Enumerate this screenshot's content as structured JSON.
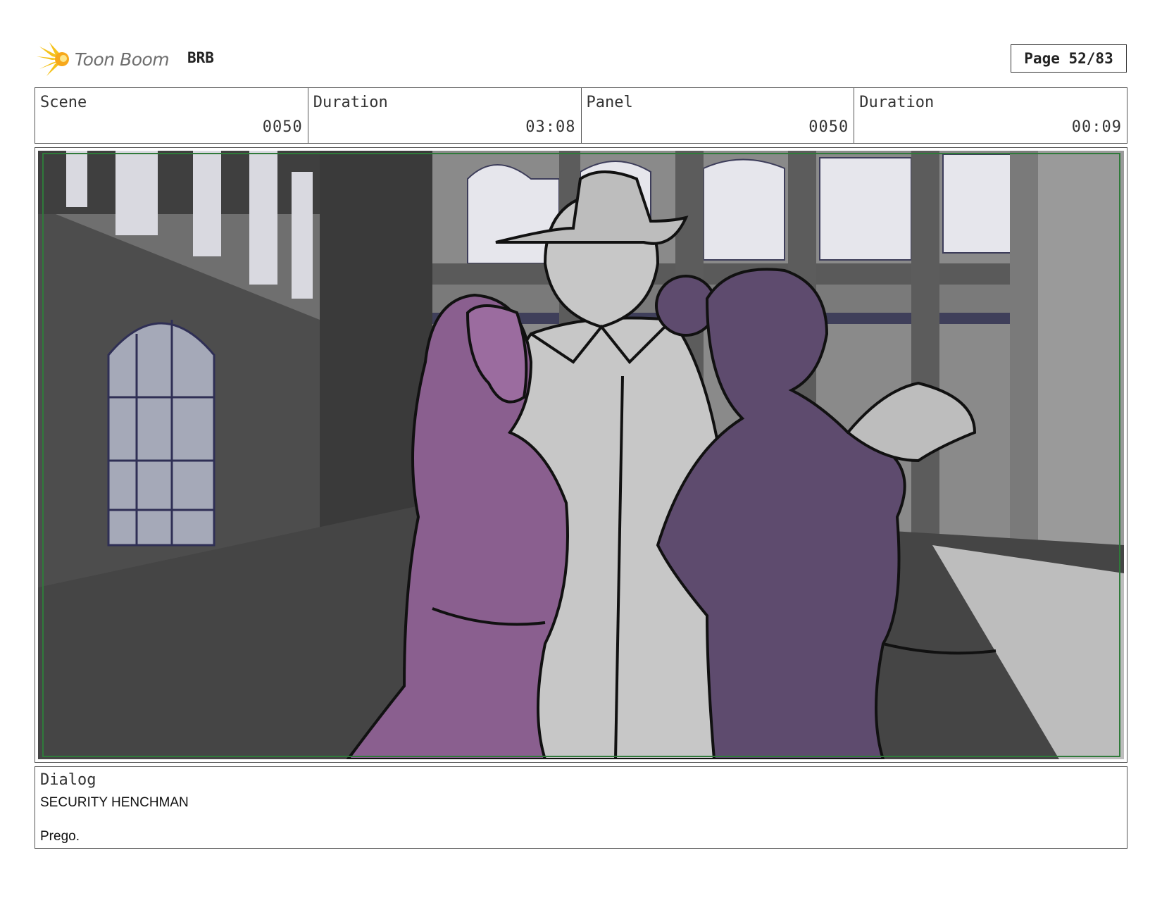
{
  "header": {
    "logo_text": "Toon Boom",
    "project": "BRB",
    "page_label": "Page 52/83"
  },
  "info": {
    "scene_label": "Scene",
    "scene_value": "0050",
    "scene_duration_label": "Duration",
    "scene_duration_value": "03:08",
    "panel_label": "Panel",
    "panel_value": "0050",
    "panel_duration_label": "Duration",
    "panel_duration_value": "00:09"
  },
  "dialog": {
    "label": "Dialog",
    "speaker": "SECURITY HENCHMAN",
    "line": "Prego."
  },
  "colors": {
    "safe_area": "#2f7a3a",
    "character_purple": "#8a5f8f",
    "character_dark_purple": "#5e4b6e",
    "character_gray": "#c7c7c7",
    "wall_gray": "#4a4a4a"
  }
}
